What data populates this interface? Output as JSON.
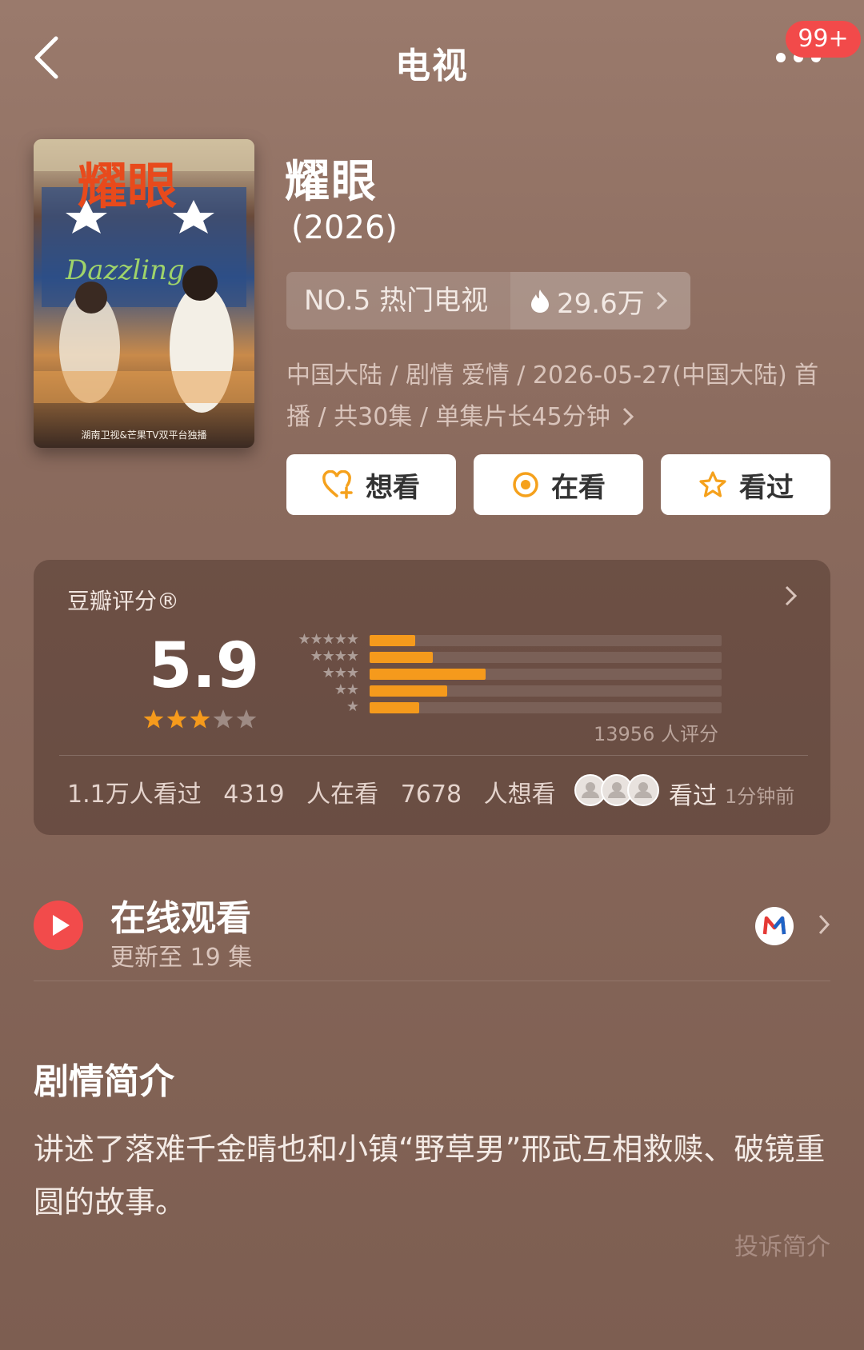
{
  "header": {
    "title": "电视",
    "notification_badge": "99+"
  },
  "show": {
    "name": "耀眼",
    "year": "(2026)",
    "rank": "NO.5 热门电视",
    "heat": "29.6万",
    "meta": "中国大陆 / 剧情 爱情 / 2026-05-27(中国大陆) 首播 / 共30集 / 单集片长45分钟"
  },
  "poster": {
    "title_art": "耀眼",
    "subtitle_art": "Dazzling",
    "credit": "湖南卫视&芒果TV双平台独播"
  },
  "actions": {
    "want": "想看",
    "watching": "在看",
    "watched": "看过"
  },
  "rating": {
    "label": "豆瓣评分®",
    "score": "5.9",
    "stars_filled": 3,
    "stars_total": 5,
    "distribution": [
      {
        "stars": 5,
        "fraction": 0.13
      },
      {
        "stars": 4,
        "fraction": 0.18
      },
      {
        "stars": 3,
        "fraction": 0.33
      },
      {
        "stars": 2,
        "fraction": 0.22
      },
      {
        "stars": 1,
        "fraction": 0.14
      }
    ],
    "count": "13956 人评分",
    "watched_count": "1.1万人看过",
    "watching_count": "4319 人在看",
    "want_count": "7678 人想看",
    "recent_action": "看过",
    "recent_time": "1分钟前"
  },
  "watch_online": {
    "title": "在线观看",
    "subtitle": "更新至 19 集"
  },
  "synopsis": {
    "title": "剧情简介",
    "text": "讲述了落难千金晴也和小镇“野草男”邢武互相救赎、破镜重圆的故事。",
    "report": "投诉简介"
  },
  "colors": {
    "accent_orange": "#f59a1c",
    "badge_red": "#f24a4a",
    "play_red": "#f24b4b"
  }
}
